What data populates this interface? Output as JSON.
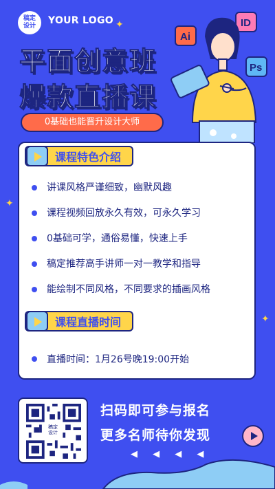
{
  "header": {
    "logo_badge": "稿定\n设计",
    "logo_text": "YOUR LOGO"
  },
  "hero": {
    "title_line1": "平面创意班",
    "title_line2": "爆款直播课",
    "subtitle": "0基础也能晋升设计大师",
    "tool_badges": [
      "Ai",
      "ID",
      "Ps"
    ]
  },
  "features_section": {
    "label": "课程特色介绍",
    "items": [
      "讲课风格严谨细致，幽默风趣",
      "课程视频回放永久有效，可永久学习",
      "0基础可学，通俗易懂，快速上手",
      "稿定推荐高手讲师一对一教学和指导",
      "能绘制不同风格，不同要求的插画风格"
    ]
  },
  "live_section": {
    "label": "课程直播时间",
    "time": "直播时间：1月26号晚19:00开始"
  },
  "footer": {
    "qr_center": "稿定\n设计",
    "scan_line1": "扫码即可参与报名",
    "scan_line2": "更多名师待你发现",
    "arrows": "◀ ◀ ◀ ◀"
  },
  "colors": {
    "background": "#3f4ff0",
    "accent_yellow": "#ffd54a",
    "accent_orange": "#ff6b4a",
    "navy": "#1d2580"
  }
}
